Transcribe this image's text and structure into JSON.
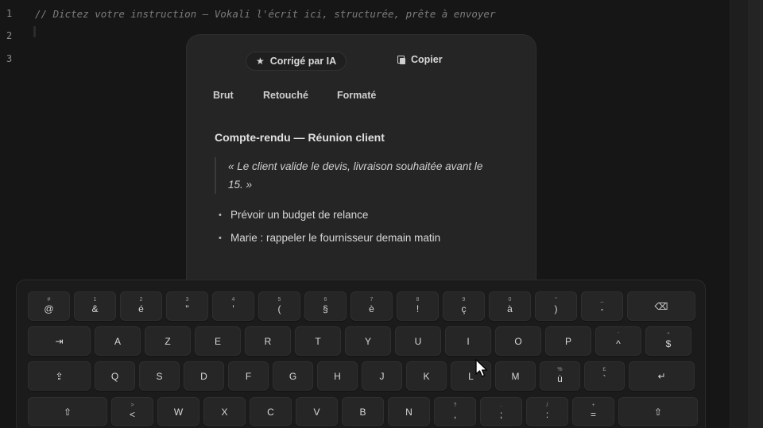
{
  "editor": {
    "lines": [
      {
        "no": "1",
        "text": "// Dictez votre instruction — Vokali l'écrit ici, structurée, prête à envoyer"
      },
      {
        "no": "2",
        "text": ""
      },
      {
        "no": "3",
        "text": ""
      }
    ]
  },
  "panel": {
    "ai_chip_label": "Corrigé par IA",
    "copy_label": "Copier",
    "tabs": [
      "Brut",
      "Retouché",
      "Formaté"
    ],
    "doc_title": "Compte-rendu — Réunion client",
    "quote": "« Le client valide le devis, livraison souhaitée avant le 15. »",
    "bullets": [
      "Prévoir un budget de relance",
      "Marie : rappeler le fournisseur demain matin"
    ]
  },
  "keyboard": {
    "rows": [
      [
        {
          "main": "@",
          "sub": "#"
        },
        {
          "main": "&",
          "sub": "1"
        },
        {
          "main": "é",
          "sub": "2"
        },
        {
          "main": "\"",
          "sub": "3"
        },
        {
          "main": "'",
          "sub": "4"
        },
        {
          "main": "(",
          "sub": "5"
        },
        {
          "main": "§",
          "sub": "6"
        },
        {
          "main": "è",
          "sub": "7"
        },
        {
          "main": "!",
          "sub": "8"
        },
        {
          "main": "ç",
          "sub": "9"
        },
        {
          "main": "à",
          "sub": "0"
        },
        {
          "main": ")",
          "sub": "°"
        },
        {
          "main": "-",
          "sub": "_"
        },
        {
          "main": "⌫",
          "sub": ""
        }
      ],
      [
        {
          "main": "⇥",
          "sub": ""
        },
        {
          "main": "A",
          "sub": ""
        },
        {
          "main": "Z",
          "sub": ""
        },
        {
          "main": "E",
          "sub": ""
        },
        {
          "main": "R",
          "sub": ""
        },
        {
          "main": "T",
          "sub": ""
        },
        {
          "main": "Y",
          "sub": ""
        },
        {
          "main": "U",
          "sub": ""
        },
        {
          "main": "I",
          "sub": ""
        },
        {
          "main": "O",
          "sub": ""
        },
        {
          "main": "P",
          "sub": ""
        },
        {
          "main": "^",
          "sub": "¨"
        },
        {
          "main": "$",
          "sub": "*"
        }
      ],
      [
        {
          "main": "⇪",
          "sub": ""
        },
        {
          "main": "Q",
          "sub": ""
        },
        {
          "main": "S",
          "sub": ""
        },
        {
          "main": "D",
          "sub": ""
        },
        {
          "main": "F",
          "sub": ""
        },
        {
          "main": "G",
          "sub": ""
        },
        {
          "main": "H",
          "sub": ""
        },
        {
          "main": "J",
          "sub": ""
        },
        {
          "main": "K",
          "sub": ""
        },
        {
          "main": "L",
          "sub": ""
        },
        {
          "main": "M",
          "sub": ""
        },
        {
          "main": "ù",
          "sub": "%"
        },
        {
          "main": "`",
          "sub": "£"
        },
        {
          "main": "↵",
          "sub": ""
        }
      ],
      [
        {
          "main": "⇧",
          "sub": ""
        },
        {
          "main": "<",
          "sub": ">"
        },
        {
          "main": "W",
          "sub": ""
        },
        {
          "main": "X",
          "sub": ""
        },
        {
          "main": "C",
          "sub": ""
        },
        {
          "main": "V",
          "sub": ""
        },
        {
          "main": "B",
          "sub": ""
        },
        {
          "main": "N",
          "sub": ""
        },
        {
          "main": ",",
          "sub": "?"
        },
        {
          "main": ";",
          "sub": "."
        },
        {
          "main": ":",
          "sub": "/"
        },
        {
          "main": "=",
          "sub": "+"
        },
        {
          "main": "⇧",
          "sub": ""
        }
      ]
    ]
  }
}
